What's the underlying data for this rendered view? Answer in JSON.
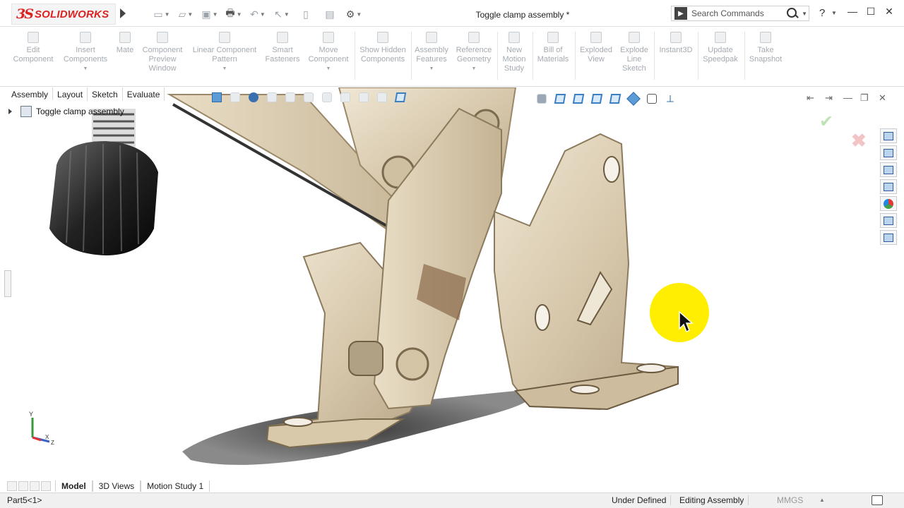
{
  "app": {
    "logo_ds": "3S",
    "logo_text": "SOLIDWORKS",
    "window_title": "Toggle clamp assembly *",
    "search_placeholder": "Search Commands",
    "help": "?"
  },
  "ribbon": {
    "buttons": [
      {
        "label": "Edit Component"
      },
      {
        "label": "Insert Components"
      },
      {
        "label": "Mate"
      },
      {
        "label": "Component Preview Window"
      },
      {
        "label": "Linear Component Pattern"
      },
      {
        "label": "Smart Fasteners"
      },
      {
        "label": "Move Component"
      },
      {
        "label": "Show Hidden Components"
      },
      {
        "label": "Assembly Features"
      },
      {
        "label": "Reference Geometry"
      },
      {
        "label": "New Motion Study"
      },
      {
        "label": "Bill of Materials"
      },
      {
        "label": "Exploded View"
      },
      {
        "label": "Explode Line Sketch"
      },
      {
        "label": "Instant3D"
      },
      {
        "label": "Update Speedpak"
      },
      {
        "label": "Take Snapshot"
      }
    ]
  },
  "tabs": [
    "Assembly",
    "Layout",
    "Sketch",
    "Evaluate"
  ],
  "tree": {
    "root_label": "Toggle clamp assembly"
  },
  "bottom_tabs": [
    "Model",
    "3D Views",
    "Motion Study 1"
  ],
  "status": {
    "left": "Part5<1>",
    "state": "Under Defined",
    "mode": "Editing Assembly",
    "units": "MMGS"
  },
  "triad": {
    "y": "Y",
    "x": "X",
    "z": "Z"
  },
  "colors": {
    "accent": "#d22222",
    "highlight": "#ffee00",
    "metal": "#d9ccb4"
  }
}
